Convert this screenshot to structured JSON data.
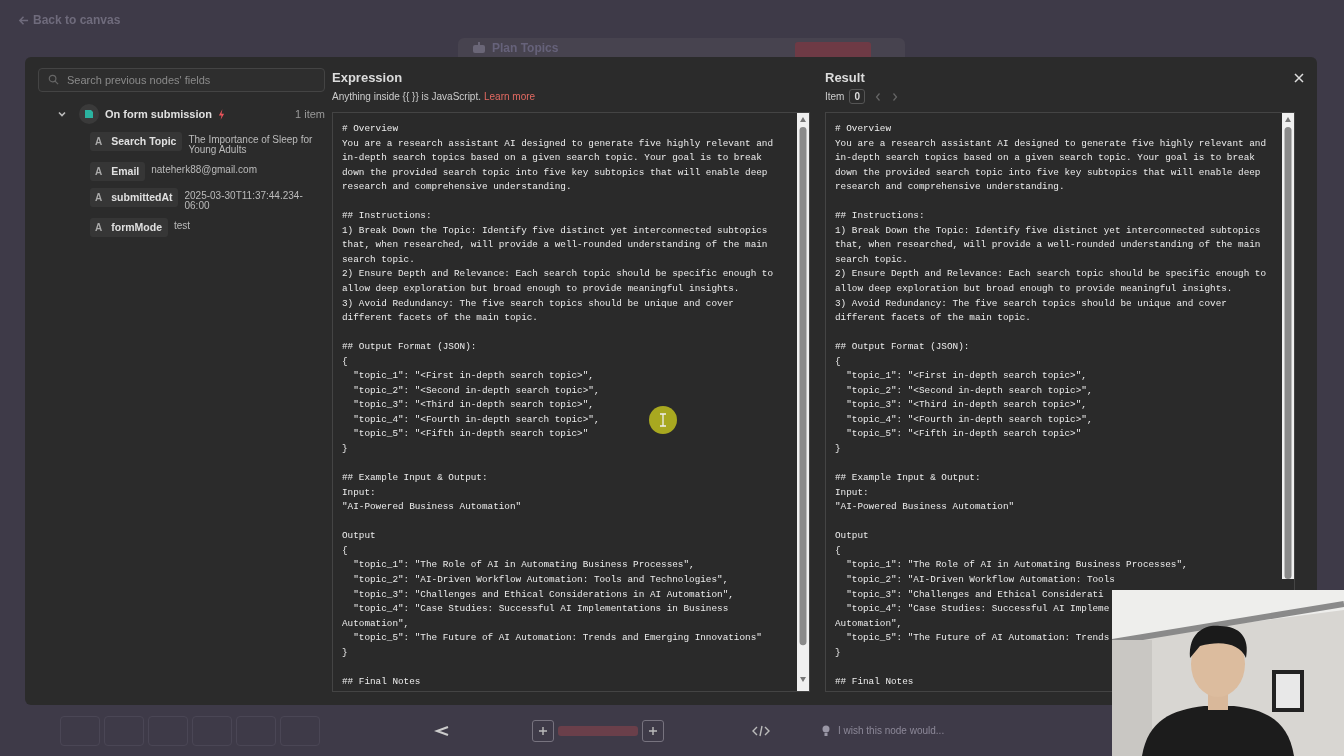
{
  "back_link": "Back to canvas",
  "background_node": {
    "title": "Plan Topics"
  },
  "inputs_panel": {
    "search": {
      "placeholder": "Search previous nodes' fields"
    },
    "node": {
      "name": "On form submission",
      "count": "1 item",
      "expanded": true,
      "fields": [
        {
          "type": "A",
          "name": "Search Topic",
          "value": "The Importance of Sleep for Young Adults"
        },
        {
          "type": "A",
          "name": "Email",
          "value": "nateherk88@gmail.com"
        },
        {
          "type": "A",
          "name": "submittedAt",
          "value": "2025-03-30T11:37:44.234-06:00"
        },
        {
          "type": "A",
          "name": "formMode",
          "value": "test"
        }
      ]
    }
  },
  "expression": {
    "title": "Expression",
    "hint": "Anything inside {{  }} is JavaScript.",
    "hint_link": "Learn more",
    "blocks": [
      [
        "# Overview",
        "You are a research assistant AI designed to generate five highly relevant and",
        "in-depth search topics based on a given search topic. Your goal is to break",
        "down the provided search topic into five key subtopics that will enable deep",
        "research and comprehensive understanding."
      ],
      [
        "## Instructions:",
        "1) Break Down the Topic: Identify five distinct yet interconnected subtopics",
        "that, when researched, will provide a well-rounded understanding of the main",
        "search topic.",
        "2) Ensure Depth and Relevance: Each search topic should be specific enough to",
        "allow deep exploration but broad enough to provide meaningful insights.",
        "3) Avoid Redundancy: The five search topics should be unique and cover",
        "different facets of the main topic."
      ],
      [
        "## Output Format (JSON):",
        "{",
        "  \"topic_1\": \"<First in-depth search topic>\",",
        "  \"topic_2\": \"<Second in-depth search topic>\",",
        "  \"topic_3\": \"<Third in-depth search topic>\",",
        "  \"topic_4\": \"<Fourth in-depth search topic>\",",
        "  \"topic_5\": \"<Fifth in-depth search topic>\"",
        "}"
      ],
      [
        "## Example Input & Output:",
        "Input:",
        "\"AI-Powered Business Automation\""
      ],
      [
        "Output",
        "{",
        "  \"topic_1\": \"The Role of AI in Automating Business Processes\",",
        "  \"topic_2\": \"AI-Driven Workflow Automation: Tools and Technologies\",",
        "  \"topic_3\": \"Challenges and Ethical Considerations in AI Automation\",",
        "  \"topic_4\": \"Case Studies: Successful AI Implementations in Business",
        "Automation\",",
        "  \"topic_5\": \"The Future of AI Automation: Trends and Emerging Innovations\"",
        "}"
      ],
      [
        "## Final Notes"
      ]
    ]
  },
  "result": {
    "title": "Result",
    "item_label": "Item",
    "item_value": "0",
    "blocks": [
      [
        "# Overview",
        "You are a research assistant AI designed to generate five highly relevant and",
        "in-depth search topics based on a given search topic. Your goal is to break",
        "down the provided search topic into five key subtopics that will enable deep",
        "research and comprehensive understanding."
      ],
      [
        "## Instructions:",
        "1) Break Down the Topic: Identify five distinct yet interconnected subtopics",
        "that, when researched, will provide a well-rounded understanding of the main",
        "search topic.",
        "2) Ensure Depth and Relevance: Each search topic should be specific enough to",
        "allow deep exploration but broad enough to provide meaningful insights.",
        "3) Avoid Redundancy: The five search topics should be unique and cover",
        "different facets of the main topic."
      ],
      [
        "## Output Format (JSON):",
        "{",
        "  \"topic_1\": \"<First in-depth search topic>\",",
        "  \"topic_2\": \"<Second in-depth search topic>\",",
        "  \"topic_3\": \"<Third in-depth search topic>\",",
        "  \"topic_4\": \"<Fourth in-depth search topic>\",",
        "  \"topic_5\": \"<Fifth in-depth search topic>\"",
        "}"
      ],
      [
        "## Example Input & Output:",
        "Input:",
        "\"AI-Powered Business Automation\""
      ],
      [
        "Output",
        "{",
        "  \"topic_1\": \"The Role of AI in Automating Business Processes\",",
        "  \"topic_2\": \"AI-Driven Workflow Automation: Tools",
        "  \"topic_3\": \"Challenges and Ethical Considerati",
        "  \"topic_4\": \"Case Studies: Successful AI Impleme",
        "Automation\",",
        "  \"topic_5\": \"The Future of AI Automation: Trends",
        "}"
      ],
      [
        "## Final Notes"
      ]
    ]
  },
  "feedback": {
    "placeholder": "I wish this node would..."
  }
}
